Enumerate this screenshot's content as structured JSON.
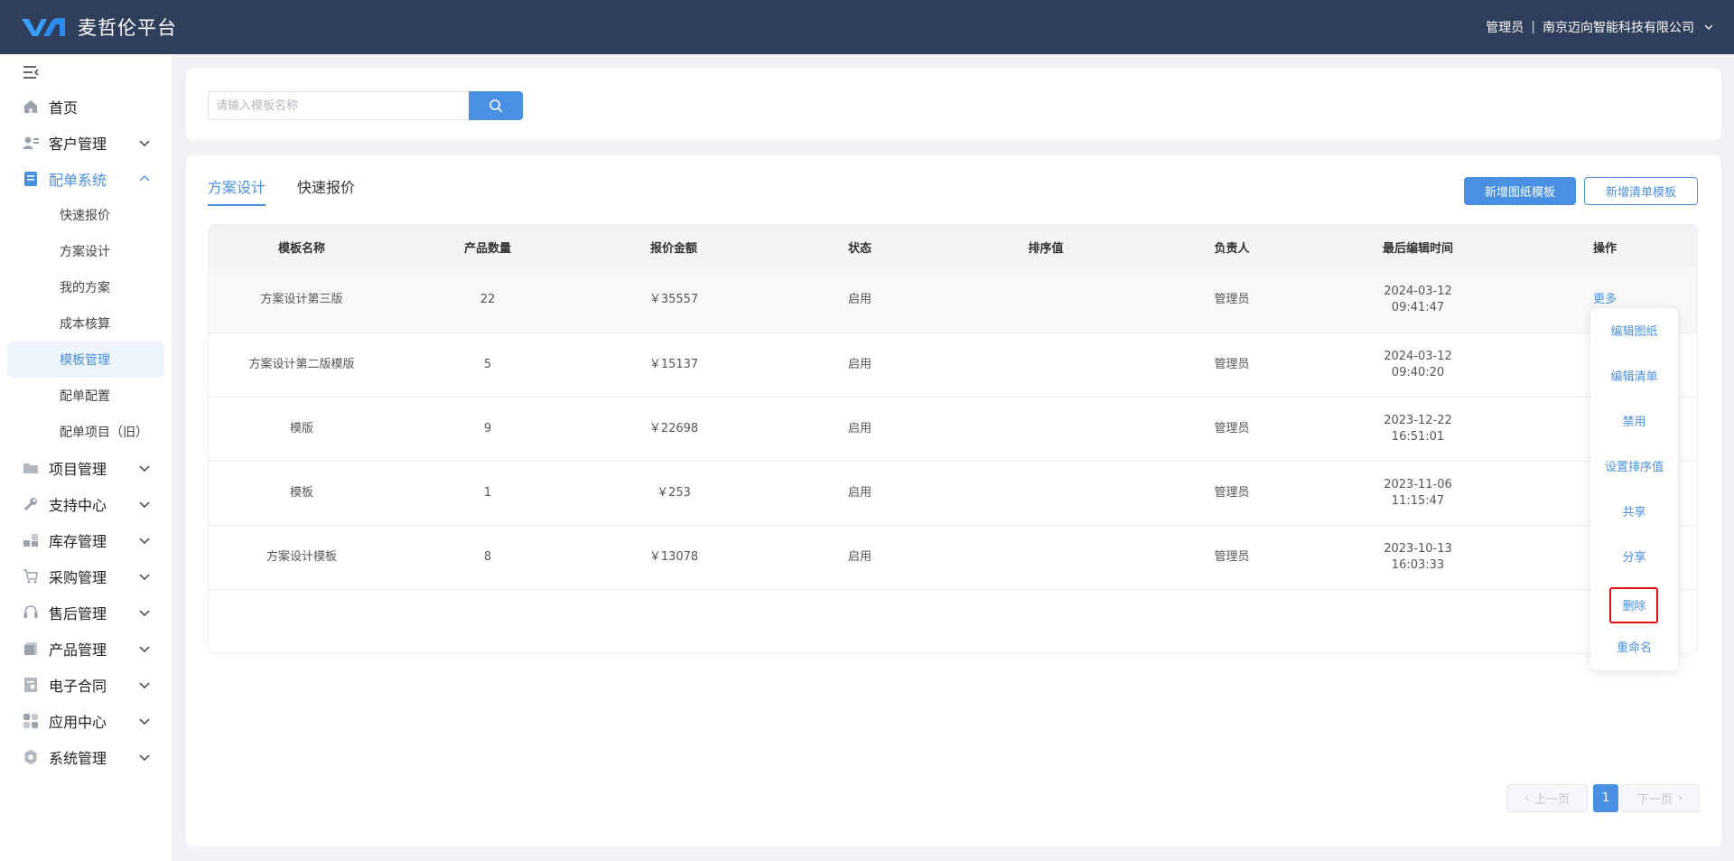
{
  "header": {
    "brand": "麦哲伦平台",
    "role": "管理员",
    "separator": "|",
    "company": "南京迈向智能科技有限公司"
  },
  "sidebar": {
    "items": [
      {
        "label": "首页",
        "icon": "home-icon"
      },
      {
        "label": "客户管理",
        "icon": "customer-icon"
      },
      {
        "label": "配单系统",
        "icon": "order-icon",
        "open": true,
        "children": [
          "快速报价",
          "方案设计",
          "我的方案",
          "成本核算",
          "模板管理",
          "配单配置",
          "配单项目（旧）"
        ],
        "active_child": "模板管理"
      },
      {
        "label": "项目管理",
        "icon": "folder-icon"
      },
      {
        "label": "支持中心",
        "icon": "wrench-icon"
      },
      {
        "label": "库存管理",
        "icon": "inventory-icon"
      },
      {
        "label": "采购管理",
        "icon": "cart-icon"
      },
      {
        "label": "售后管理",
        "icon": "headset-icon"
      },
      {
        "label": "产品管理",
        "icon": "box-icon"
      },
      {
        "label": "电子合同",
        "icon": "contract-icon"
      },
      {
        "label": "应用中心",
        "icon": "apps-icon"
      },
      {
        "label": "系统管理",
        "icon": "gear-icon"
      }
    ]
  },
  "search": {
    "placeholder": "请输入模板名称",
    "value": ""
  },
  "tabs": [
    {
      "label": "方案设计",
      "active": true
    },
    {
      "label": "快速报价",
      "active": false
    }
  ],
  "toolbar": {
    "add_drawing_template": "新增图纸模板",
    "add_list_template": "新增清单模板"
  },
  "table": {
    "columns": [
      "模板名称",
      "产品数量",
      "报价金额",
      "状态",
      "排序值",
      "负责人",
      "最后编辑时间",
      "操作"
    ],
    "rows": [
      {
        "name": "方案设计第三版",
        "qty": "22",
        "amount": "￥35557",
        "status": "启用",
        "sort": "",
        "owner": "管理员",
        "date": "2024-03-12",
        "time": "09:41:47",
        "action": "更多"
      },
      {
        "name": "方案设计第二版模版",
        "qty": "5",
        "amount": "￥15137",
        "status": "启用",
        "sort": "",
        "owner": "管理员",
        "date": "2024-03-12",
        "time": "09:40:20",
        "action": ""
      },
      {
        "name": "模版",
        "qty": "9",
        "amount": "￥22698",
        "status": "启用",
        "sort": "",
        "owner": "管理员",
        "date": "2023-12-22",
        "time": "16:51:01",
        "action": ""
      },
      {
        "name": "模板",
        "qty": "1",
        "amount": "￥253",
        "status": "启用",
        "sort": "",
        "owner": "管理员",
        "date": "2023-11-06",
        "time": "11:15:47",
        "action": ""
      },
      {
        "name": "方案设计模板",
        "qty": "8",
        "amount": "￥13078",
        "status": "启用",
        "sort": "",
        "owner": "管理员",
        "date": "2023-10-13",
        "time": "16:03:33",
        "action": ""
      }
    ]
  },
  "dropdown": {
    "items": [
      "编辑图纸",
      "编辑清单",
      "禁用",
      "设置排序值",
      "共享",
      "分享",
      "删除",
      "重命名"
    ],
    "highlighted": "删除"
  },
  "pagination": {
    "prev": "上一页",
    "current": "1",
    "next": "下一页"
  },
  "colors": {
    "header_bg": "#2f3e5b",
    "accent": "#4a90e2",
    "highlight_border": "#e01010"
  }
}
